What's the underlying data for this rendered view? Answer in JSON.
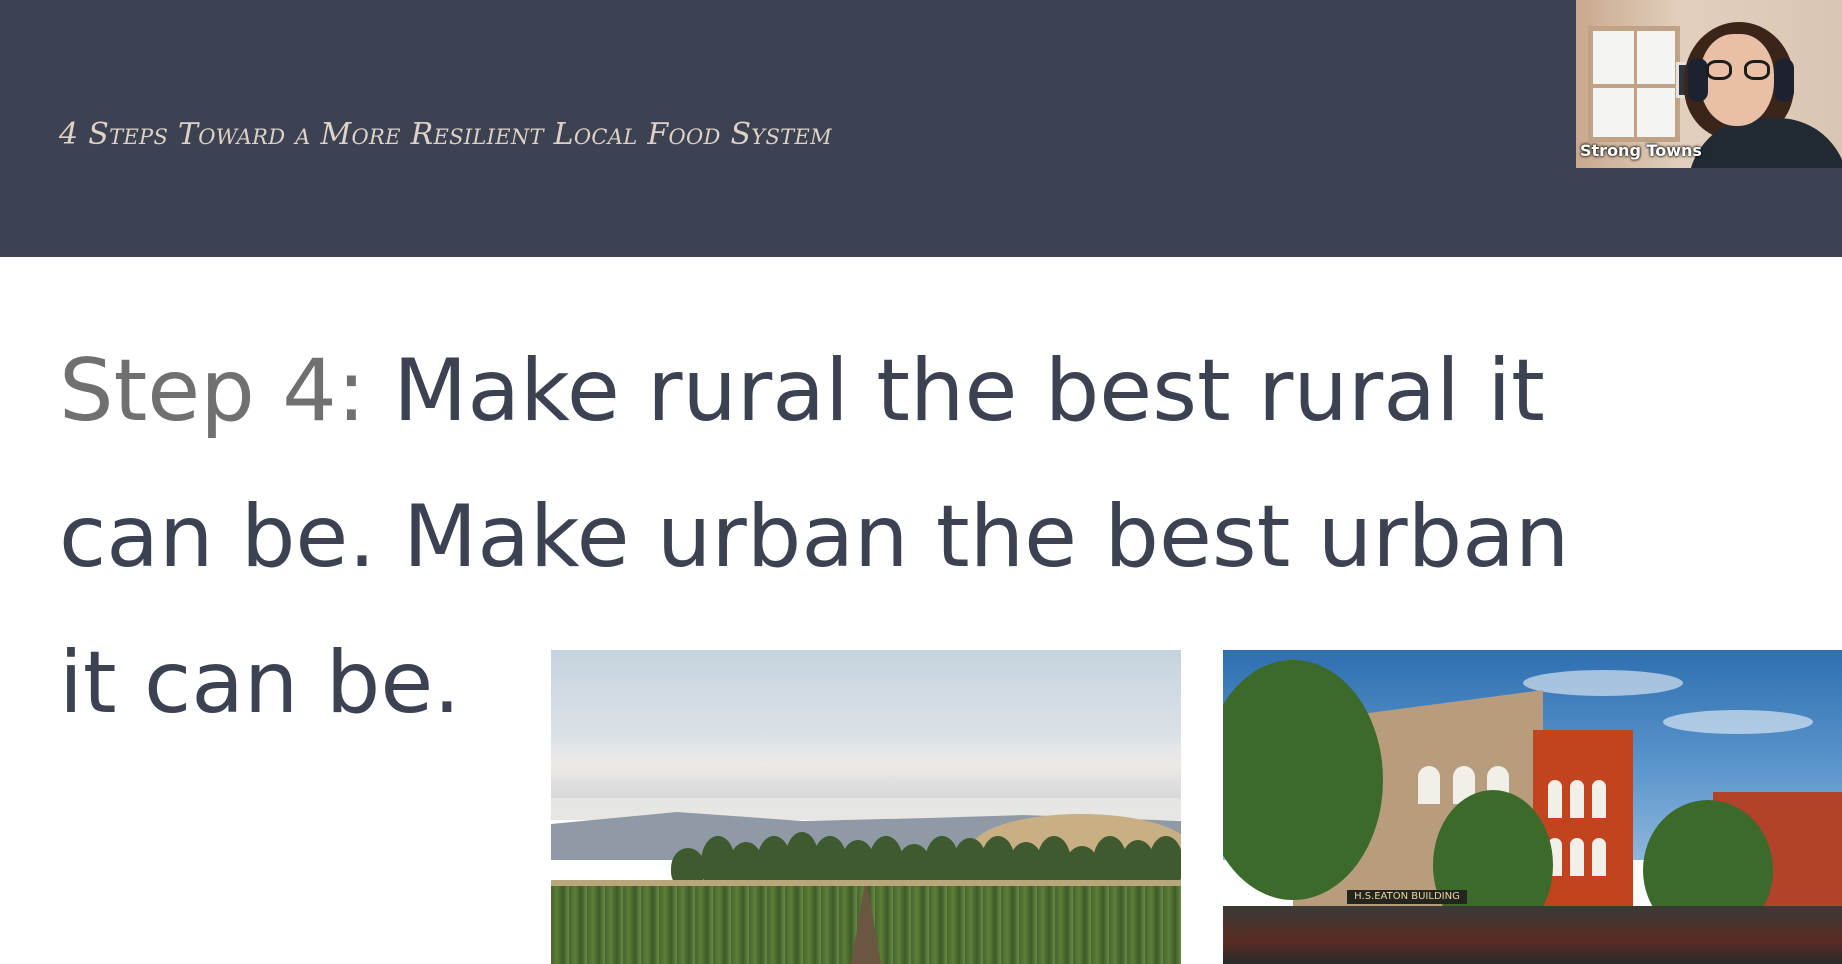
{
  "slide": {
    "header_title": "4 Steps Toward a More Resilient Local Food System",
    "step_prefix": "Step 4:",
    "title_rest": " Make rural the best rural it can be. Make urban the best urban it can be."
  },
  "video_tile": {
    "participant_name": "Strong Towns"
  },
  "images": {
    "rural_photo": "farm field with trees and hills",
    "urban_photo": "historic brick downtown main street",
    "urban_sign_text": "H.S.EATON BUILDING"
  },
  "colors": {
    "header_background": "#3d4252",
    "header_text": "#ddd2c8",
    "title_text": "#3d4252",
    "step_prefix_text": "#707070"
  }
}
